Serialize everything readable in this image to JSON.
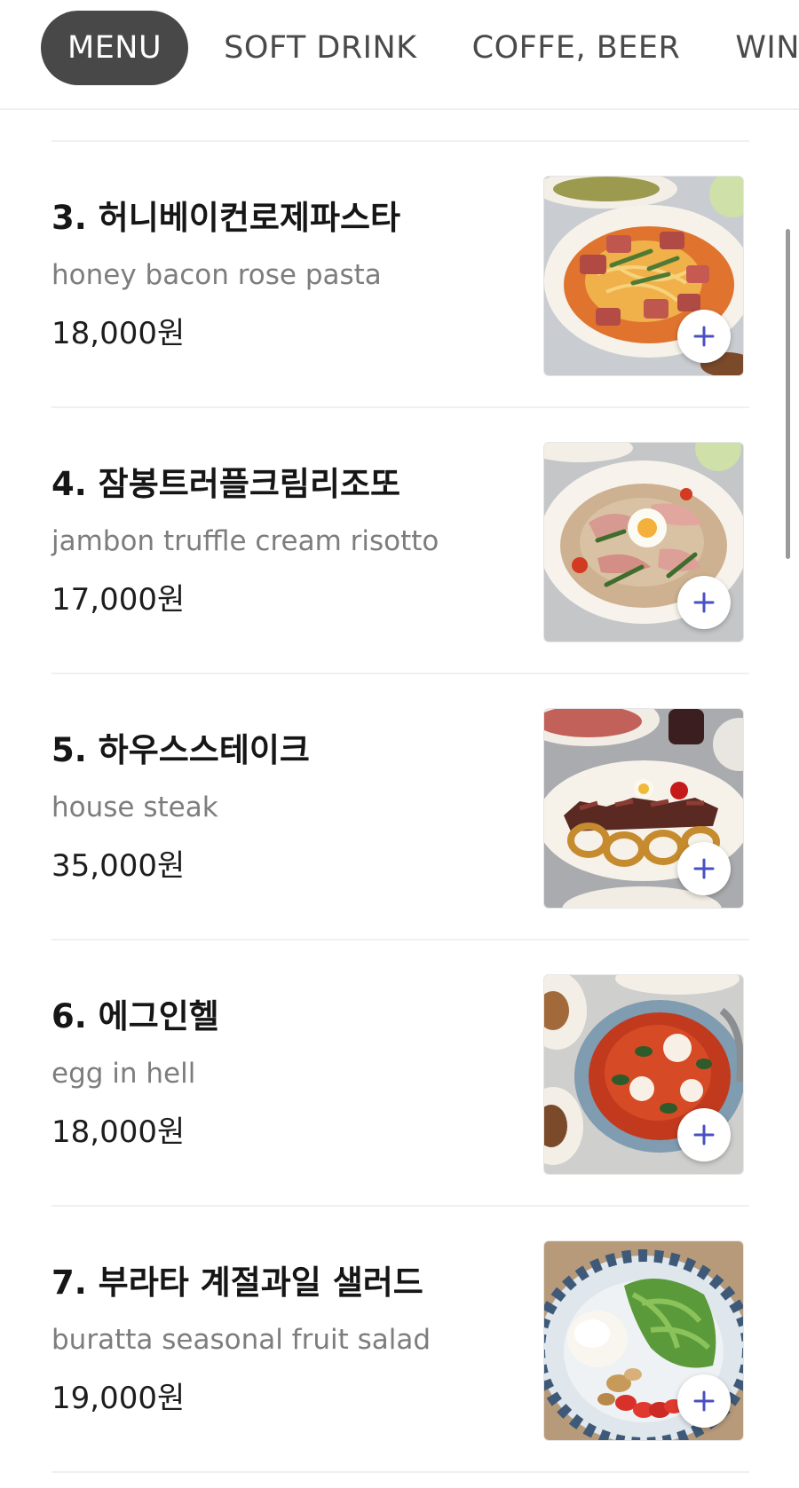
{
  "tabs": [
    {
      "label": "MENU",
      "active": true
    },
    {
      "label": "SOFT DRINK",
      "active": false
    },
    {
      "label": "COFFE, BEER",
      "active": false
    },
    {
      "label": "WIN",
      "active": false
    }
  ],
  "items": [
    {
      "title": "3. 허니베이컨로제파스타",
      "english": "honey bacon rose pasta",
      "price": "18,000원",
      "image_icon": "pasta-dish-photo"
    },
    {
      "title": "4. 잠봉트러플크림리조또",
      "english": "jambon truffle cream risotto",
      "price": "17,000원",
      "image_icon": "risotto-dish-photo"
    },
    {
      "title": "5. 하우스스테이크",
      "english": "house steak",
      "price": "35,000원",
      "image_icon": "steak-dish-photo"
    },
    {
      "title": "6. 에그인헬",
      "english": "egg in hell",
      "price": "18,000원",
      "image_icon": "egg-in-hell-dish-photo"
    },
    {
      "title": "7. 부라타 계절과일 샐러드",
      "english": "buratta seasonal fruit salad",
      "price": "19,000원",
      "image_icon": "salad-dish-photo"
    }
  ],
  "add_icon": "plus-icon",
  "colors": {
    "tab_active_bg": "#484848",
    "add_plus": "#4a4fc4",
    "text_secondary": "#7d7d7d"
  }
}
